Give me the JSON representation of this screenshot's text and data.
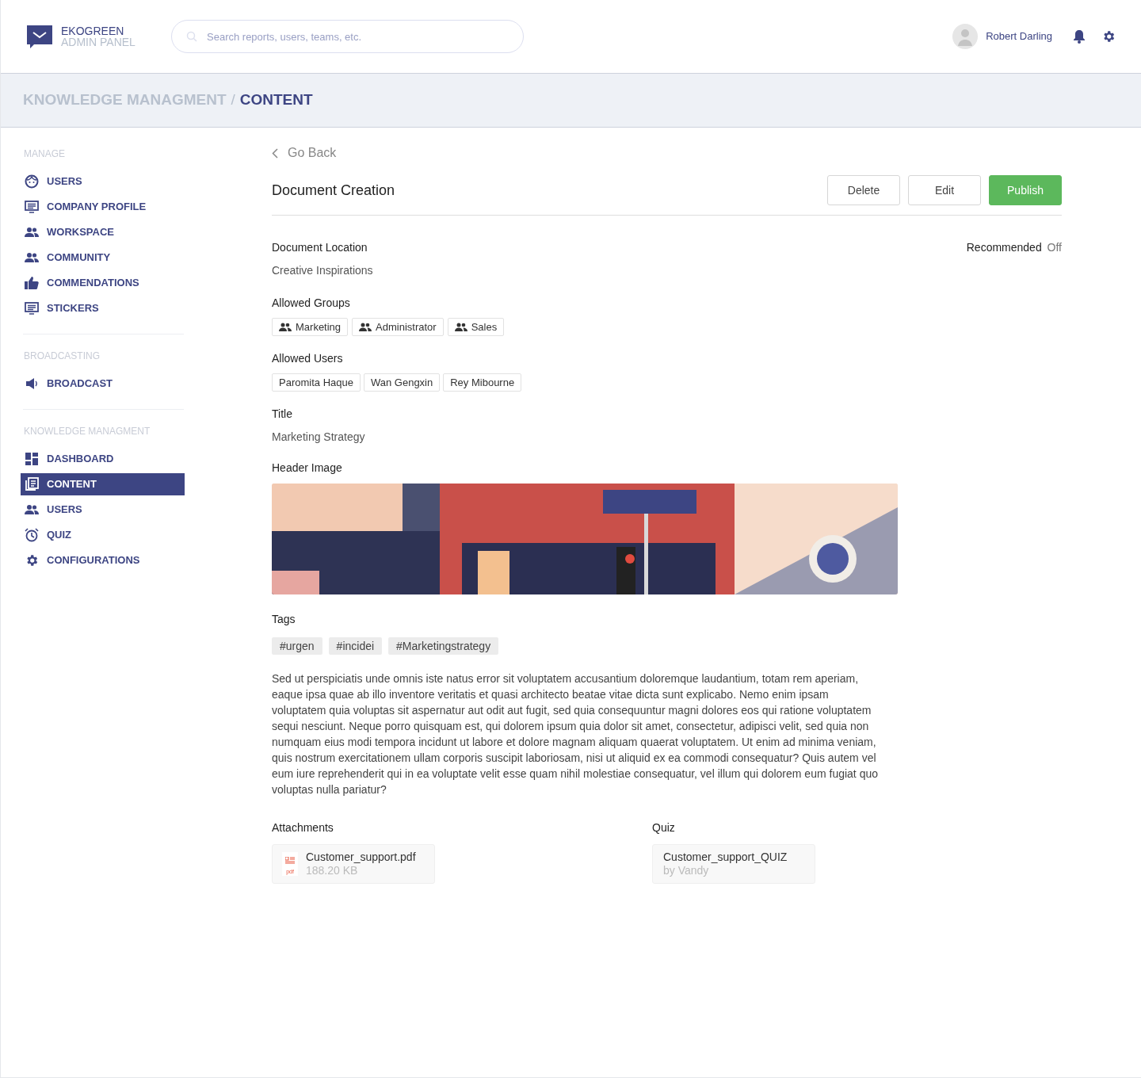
{
  "brand": {
    "name": "EKOGREEN",
    "subtitle": "ADMIN PANEL"
  },
  "search": {
    "placeholder": "Search reports, users, teams, etc."
  },
  "user": {
    "name": "Robert Darling"
  },
  "breadcrumb": {
    "parent": "KNOWLEDGE MANAGMENT",
    "separator": "/",
    "current": "CONTENT"
  },
  "sidebar": {
    "sections": [
      {
        "heading": "MANAGE",
        "items": [
          {
            "label": "USERS",
            "selected": false
          },
          {
            "label": "COMPANY PROFILE",
            "selected": false
          },
          {
            "label": "WORKSPACE",
            "selected": false
          },
          {
            "label": "COMMUNITY",
            "selected": false
          },
          {
            "label": "COMMENDATIONS",
            "selected": false
          },
          {
            "label": "STICKERS",
            "selected": false
          }
        ]
      },
      {
        "heading": "BROADCASTING",
        "items": [
          {
            "label": "BROADCAST",
            "selected": false
          }
        ]
      },
      {
        "heading": "KNOWLEDGE MANAGMENT",
        "items": [
          {
            "label": "DASHBOARD",
            "selected": false
          },
          {
            "label": "CONTENT",
            "selected": true
          },
          {
            "label": "USERS",
            "selected": false
          },
          {
            "label": "QUIZ",
            "selected": false
          },
          {
            "label": "CONFIGURATIONS",
            "selected": false
          }
        ]
      }
    ]
  },
  "back_link": "Go Back",
  "page_title": "Document Creation",
  "buttons": [
    {
      "label": "Delete",
      "kind": "secondary"
    },
    {
      "label": "Edit",
      "kind": "secondary"
    },
    {
      "label": "Publish",
      "kind": "primary"
    }
  ],
  "recommended": {
    "label": "Recommended",
    "value": "Off"
  },
  "document_location": {
    "label": "Document Location",
    "value": "Creative Inspirations"
  },
  "allowed_groups": {
    "label": "Allowed Groups",
    "items": [
      "Marketing",
      "Administrator",
      "Sales"
    ]
  },
  "allowed_users": {
    "label": "Allowed Users",
    "items": [
      "Paromita Haque",
      "Wan Gengxin",
      "Rey Mibourne"
    ]
  },
  "title": {
    "label": "Title",
    "value": "Marketing Strategy"
  },
  "header_image": {
    "label": "Header Image",
    "kind": "picture"
  },
  "tags": {
    "label": "Tags",
    "items": [
      "#urgen",
      "#incidei",
      "#Marketingstrategy"
    ]
  },
  "description": "Sed ut perspiciatis unde omnis iste natus error sit voluptatem accusantium doloremque laudantium, totam rem aperiam, eaque ipsa quae ab illo inventore veritatis et quasi architecto beatae vitae dicta sunt explicabo. Nemo enim ipsam voluptatem quia voluptas sit aspernatur aut odit aut fugit, sed quia consequuntur magni dolores eos qui ratione voluptatem sequi nesciunt. Neque porro quisquam est, qui dolorem ipsum quia dolor sit amet, consectetur, adipisci velit, sed quia non numquam eius modi tempora incidunt ut labore et dolore magnam aliquam quaerat voluptatem. Ut enim ad minima veniam, quis nostrum exercitationem ullam corporis suscipit laboriosam, nisi ut aliquid ex ea commodi consequatur? Quis autem vel eum iure reprehenderit qui in ea voluptate velit esse quam nihil molestiae consequatur, vel illum qui dolorem eum fugiat quo voluptas nulla pariatur?",
  "attachments": {
    "label": "Attachments",
    "items": [
      {
        "file_type": "pdf",
        "name": "Customer_support.pdf",
        "size": "188.20 KB"
      }
    ]
  },
  "quiz": {
    "label": "Quiz",
    "items": [
      {
        "name": "Customer_support_QUIZ",
        "author": "by Vandy"
      }
    ]
  }
}
